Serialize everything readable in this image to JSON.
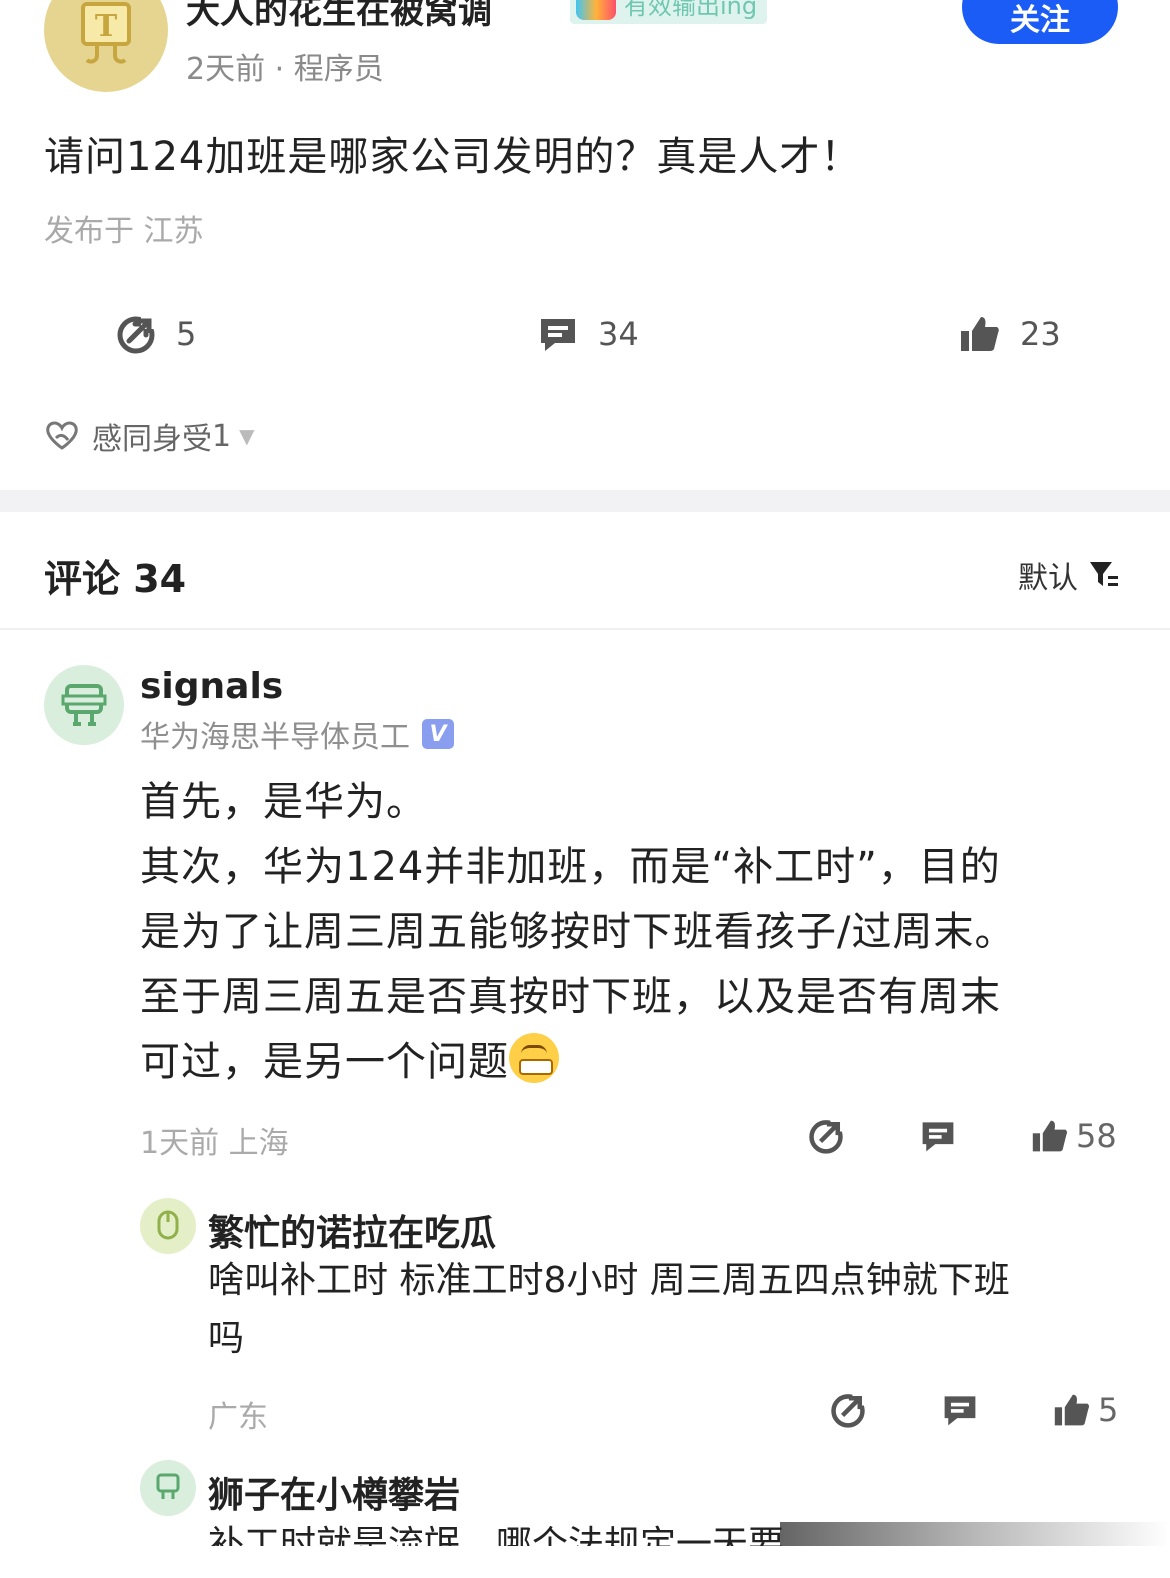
{
  "post": {
    "author_name": "大人的花生在被窝调",
    "badge_text": "有效输出ing",
    "meta": "2天前 · 程序员",
    "follow_label": "关注",
    "text": "请问124加班是哪家公司发明的？真是人才！",
    "location": "发布于 江苏",
    "actions": {
      "forward_count": "5",
      "comment_count": "34",
      "like_count": "23"
    },
    "reaction": {
      "label": "感同身受",
      "count": "1"
    }
  },
  "comments_header": {
    "title": "评论 34",
    "sort_label": "默认"
  },
  "comments": [
    {
      "name": "signals",
      "subtitle": "华为海思半导体员工",
      "verified_mark": "V",
      "body_lines": [
        "首先，是华为。",
        "其次，华为124并非加班，而是“补工时”，目的",
        "是为了让周三周五能够按时下班看孩子/过周末。",
        "至于周三周五是否真按时下班，以及是否有周末",
        "可过，是另一个问题"
      ],
      "footer": "1天前  上海",
      "like_count": "58"
    },
    {
      "name": "繁忙的诺拉在吃瓜",
      "body_lines": [
        "啥叫补工时 标准工时8小时 周三周五四点钟就下班",
        "吗"
      ],
      "footer": "广东",
      "like_count": "5"
    },
    {
      "name": "狮子在小樽攀岩",
      "body_lines": [
        "补工时就是流氓，哪个法规定一天要"
      ]
    }
  ],
  "colors": {
    "accent": "#1a5cf5",
    "badge_bg": "#dff3ee",
    "verified": "#8a9ef0",
    "separator": "#f2f2f4"
  }
}
